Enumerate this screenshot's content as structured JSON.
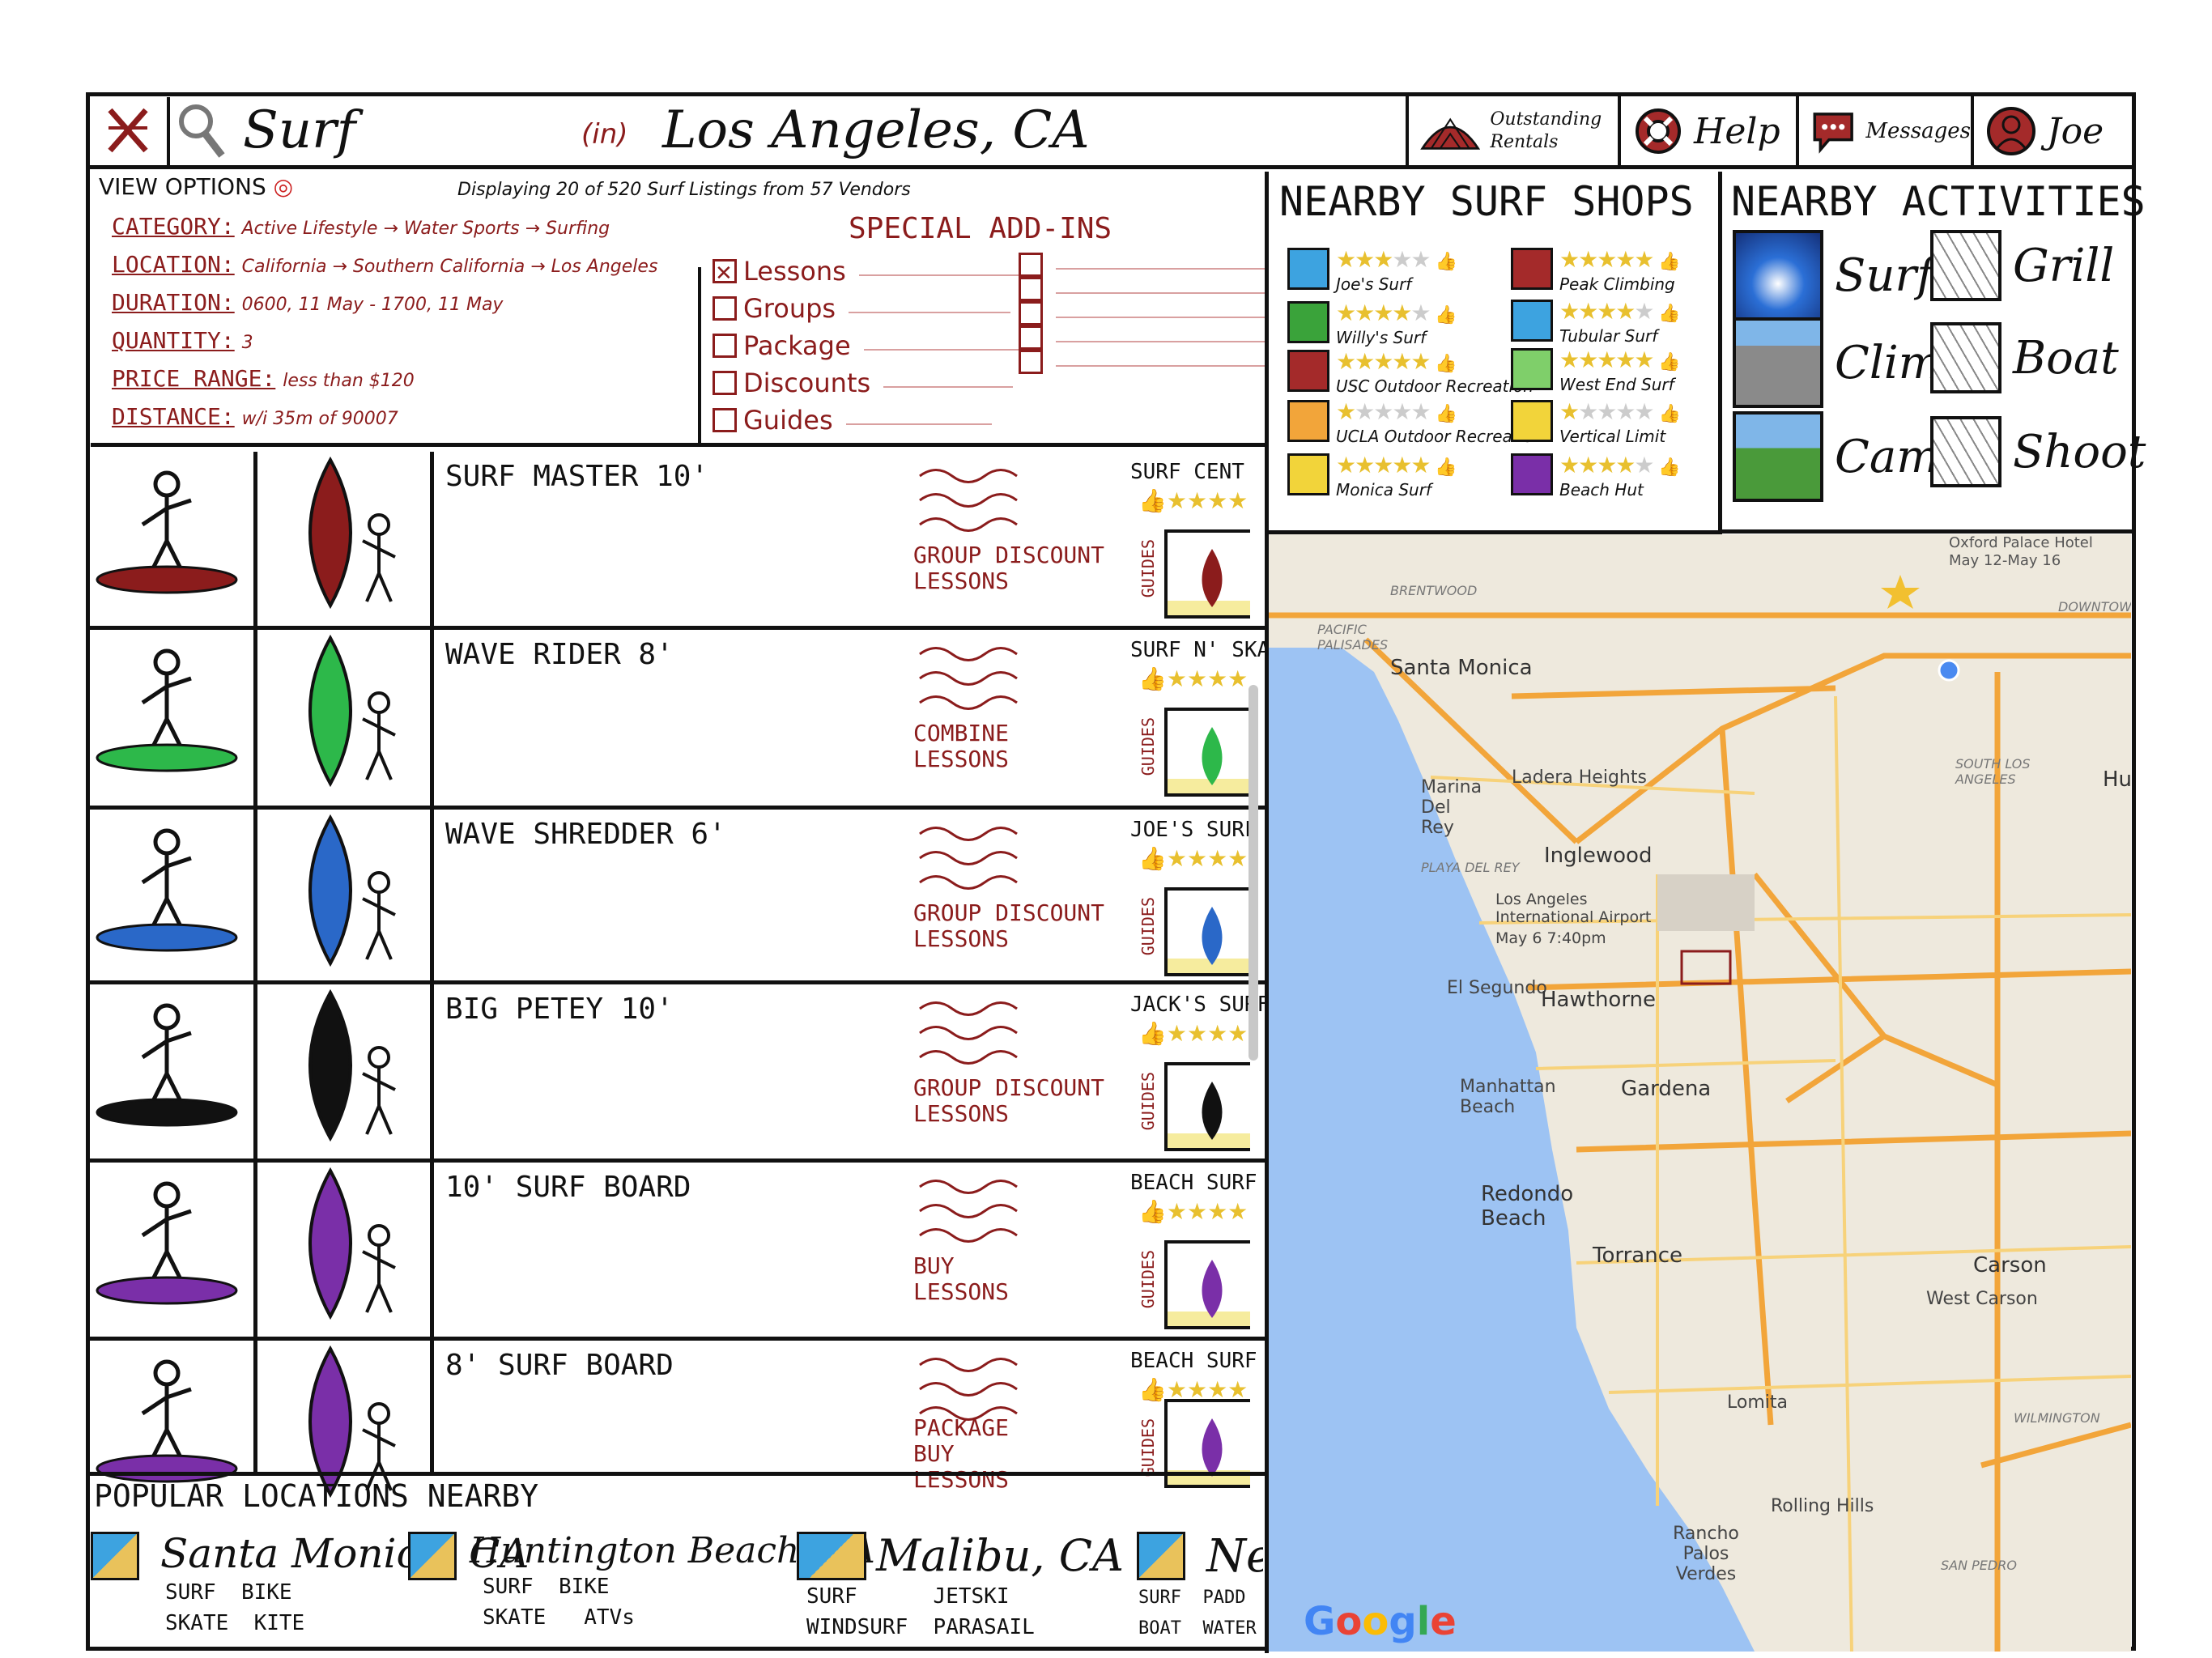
{
  "topbar": {
    "search_term": "Surf",
    "in_label": "(in)",
    "location": "Los Angeles, CA",
    "nav": [
      {
        "label": "Outstanding Rentals",
        "icon": "tent-icon"
      },
      {
        "label": "Help",
        "icon": "lifebuoy-icon"
      },
      {
        "label": "Messages",
        "icon": "chat-icon"
      },
      {
        "label": "Joe",
        "icon": "user-icon"
      }
    ]
  },
  "view_options": {
    "title": "VIEW OPTIONS",
    "display_text": "Displaying 20 of 520 Surf Listings from 57 Vendors",
    "filters": [
      {
        "key": "CATEGORY:",
        "value": "Active Lifestyle → Water Sports → Surfing"
      },
      {
        "key": "LOCATION:",
        "value": "California → Southern California → Los Angeles"
      },
      {
        "key": "DURATION:",
        "value": "0600, 11 May - 1700, 11 May"
      },
      {
        "key": "QUANTITY:",
        "value": "3"
      },
      {
        "key": "PRICE RANGE:",
        "value": "less than $120"
      },
      {
        "key": "DISTANCE:",
        "value": "w/i 35m of 90007"
      }
    ]
  },
  "addins": {
    "title": "SPECIAL ADD-INS",
    "items": [
      {
        "label": "Lessons",
        "checked": true
      },
      {
        "label": "Groups",
        "checked": false
      },
      {
        "label": "Package",
        "checked": false
      },
      {
        "label": "Discounts",
        "checked": false
      },
      {
        "label": "Guides",
        "checked": false
      }
    ]
  },
  "listings": [
    {
      "name": "SURF MASTER 10'",
      "deal1": "GROUP DISCOUNT",
      "deal2": "LESSONS",
      "vendor": "SURF CENT",
      "guides": "GUIDES",
      "board_color": "#8b1c1c"
    },
    {
      "name": "WAVE RIDER 8'",
      "deal1": "COMBINE",
      "deal2": "LESSONS",
      "vendor": "SURF N' SKATE",
      "guides": "GUIDES",
      "board_color": "#2db84a"
    },
    {
      "name": "WAVE SHREDDER 6'",
      "deal1": "GROUP DISCOUNT",
      "deal2": "LESSONS",
      "vendor": "JOE'S SURF",
      "guides": "GUIDES",
      "board_color": "#2a68c8"
    },
    {
      "name": "BIG PETEY 10'",
      "deal1": "GROUP DISCOUNT",
      "deal2": "LESSONS",
      "vendor": "JACK'S SURF",
      "guides": "GUIDES",
      "board_color": "#111111"
    },
    {
      "name": "10' SURF BOARD",
      "deal1": "BUY",
      "deal2": "LESSONS",
      "vendor": "BEACH SURF",
      "guides": "GUIDES",
      "board_color": "#7a2fa8"
    },
    {
      "name": "8' SURF BOARD",
      "deal1": "PACKAGE",
      "deal2": "BUY",
      "deal3": "LESSONS",
      "vendor": "BEACH SURF",
      "guides": "GUIDES",
      "board_color": "#7a2fa8"
    }
  ],
  "popular": {
    "title": "POPULAR LOCATIONS NEARBY",
    "items": [
      {
        "name": "Santa Monica, CA",
        "a1": "SURF",
        "a2": "BIKE",
        "a3": "SKATE",
        "a4": "KITE"
      },
      {
        "name": "Huntington Beach, CA",
        "a1": "SURF",
        "a2": "BIKE",
        "a3": "SKATE",
        "a4": "ATVs"
      },
      {
        "name": "Malibu, CA",
        "a1": "SURF",
        "a2": "JETSKI",
        "a3": "WINDSURF",
        "a4": "PARASAIL"
      },
      {
        "name": "Ne",
        "a1": "SURF",
        "a2": "PADD",
        "a3": "BOAT",
        "a4": "WATER"
      }
    ]
  },
  "shops": {
    "title": "NEARBY SURF SHOPS",
    "items": [
      {
        "name": "Joe's Surf",
        "stars": 3
      },
      {
        "name": "Willy's Surf",
        "stars": 4
      },
      {
        "name": "USC Outdoor Recreation",
        "stars": 5
      },
      {
        "name": "UCLA Outdoor Recreation",
        "stars": 1
      },
      {
        "name": "Monica Surf",
        "stars": 5
      },
      {
        "name": "Peak Climbing",
        "stars": 5
      },
      {
        "name": "Tubular Surf",
        "stars": 4
      },
      {
        "name": "West End Surf",
        "stars": 5
      },
      {
        "name": "Vertical Limit",
        "stars": 1
      },
      {
        "name": "Beach Hut",
        "stars": 4
      }
    ]
  },
  "activities": {
    "title": "NEARBY ACTIVITIES",
    "items": [
      {
        "label": "Surf"
      },
      {
        "label": "Grill"
      },
      {
        "label": "Climb"
      },
      {
        "label": "Boat"
      },
      {
        "label": "Camp"
      },
      {
        "label": "Shoot"
      }
    ]
  },
  "map": {
    "labels": {
      "brentwood": "BRENTWOOD",
      "pacific_palisades": "PACIFIC PALISADES",
      "santa_monica": "Santa Monica",
      "marina": "Marina Del Rey",
      "playa": "PLAYA DEL REY",
      "ladera": "Ladera Heights",
      "inglewood": "Inglewood",
      "lax": "Los Angeles International Airport",
      "lax_date": "May 6 7:40pm",
      "el_segundo": "El Segundo",
      "hawthorne": "Hawthorne",
      "manhattan": "Manhattan Beach",
      "gardena": "Gardena",
      "redondo": "Redondo Beach",
      "torrance": "Torrance",
      "carson": "Carson",
      "west_carson": "West Carson",
      "lomita": "Lomita",
      "wilmington": "WILMINGTON",
      "rolling_hills": "Rolling Hills",
      "rancho": "Rancho Palos Verdes",
      "san_pedro": "SAN PEDRO",
      "downtown": "DOWNTOW",
      "south_la": "SOUTH LOS ANGELES",
      "hu": "Hu",
      "hotel": "Oxford Palace Hotel",
      "hotel_dates": "May 12-May 16"
    },
    "google": "Google"
  },
  "colors": {
    "accent": "#8b1c1c",
    "star": "#e8c02f",
    "water": "#9dc3f3",
    "land": "#eee9dd",
    "highway": "#f2a53a"
  }
}
